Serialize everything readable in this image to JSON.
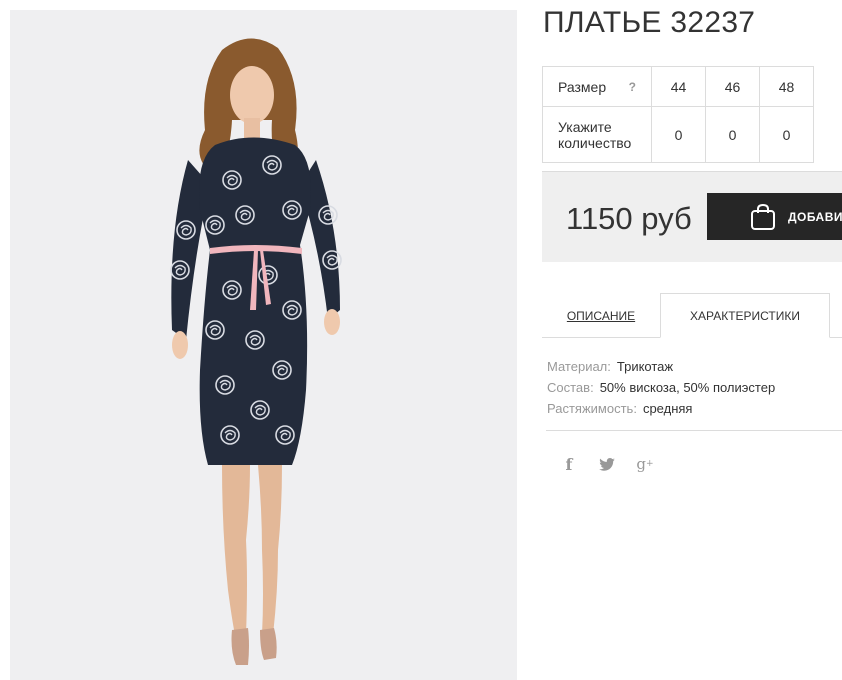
{
  "product": {
    "title": "ПЛАТЬЕ 32237",
    "image_alt": "Model wearing a dark blue knit dress with white rose print and a pink belt"
  },
  "sizes": {
    "size_label": "Размер",
    "help_glyph": "?",
    "qty_label_line1": "Укажите",
    "qty_label_line2": "количество",
    "items": [
      {
        "size": "44",
        "qty": "0"
      },
      {
        "size": "46",
        "qty": "0"
      },
      {
        "size": "48",
        "qty": "0"
      }
    ]
  },
  "buy": {
    "price": "1150 руб",
    "add_label": "ДОБАВИТЬ В КОРЗИНУ"
  },
  "tabs": {
    "description": "ОПИСАНИЕ",
    "characteristics": "ХАРАКТЕРИСТИКИ"
  },
  "properties": [
    {
      "key": "Материал:",
      "value": "Трикотаж"
    },
    {
      "key": "Состав:",
      "value": "50% вискоза, 50% полиэстер"
    },
    {
      "key": "Растяжимость:",
      "value": "средняя"
    }
  ],
  "social": {
    "facebook_glyph": "f",
    "googleplus_glyph": "g"
  },
  "colors": {
    "dress": "#232b3b",
    "belt": "#f1b6bd",
    "button": "#262626",
    "photo_bg": "#efeff1"
  }
}
